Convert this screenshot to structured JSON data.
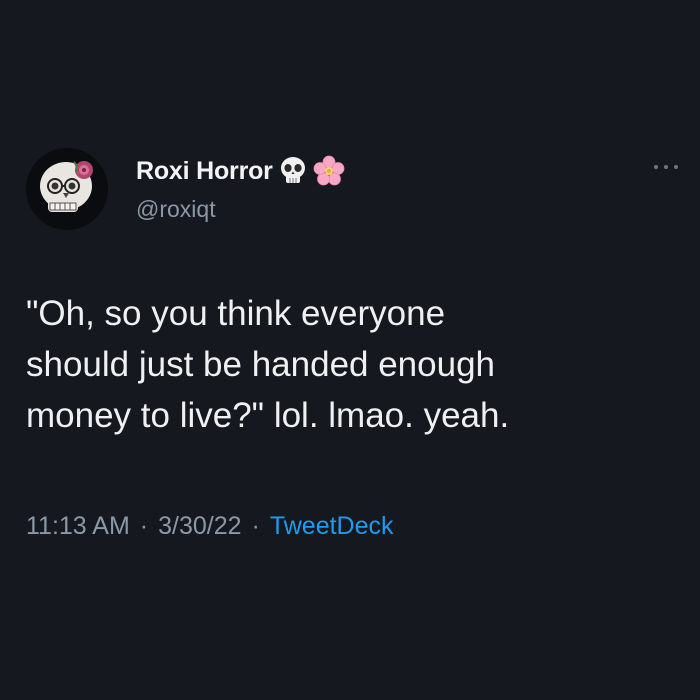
{
  "tweet": {
    "display_name": "Roxi Horror",
    "handle": "@roxiqt",
    "name_emojis": [
      "skull-icon",
      "cherry-blossom-icon"
    ],
    "text": "\"Oh, so you think everyone\nshould just be handed enough\nmoney to live?\" lol. lmao. yeah.",
    "time": "11:13 AM",
    "date": "3/30/22",
    "separator": "·",
    "source": "TweetDeck"
  },
  "colors": {
    "background": "#16181f",
    "secondary_text": "#8b98a5",
    "link": "#1d9bf0"
  }
}
